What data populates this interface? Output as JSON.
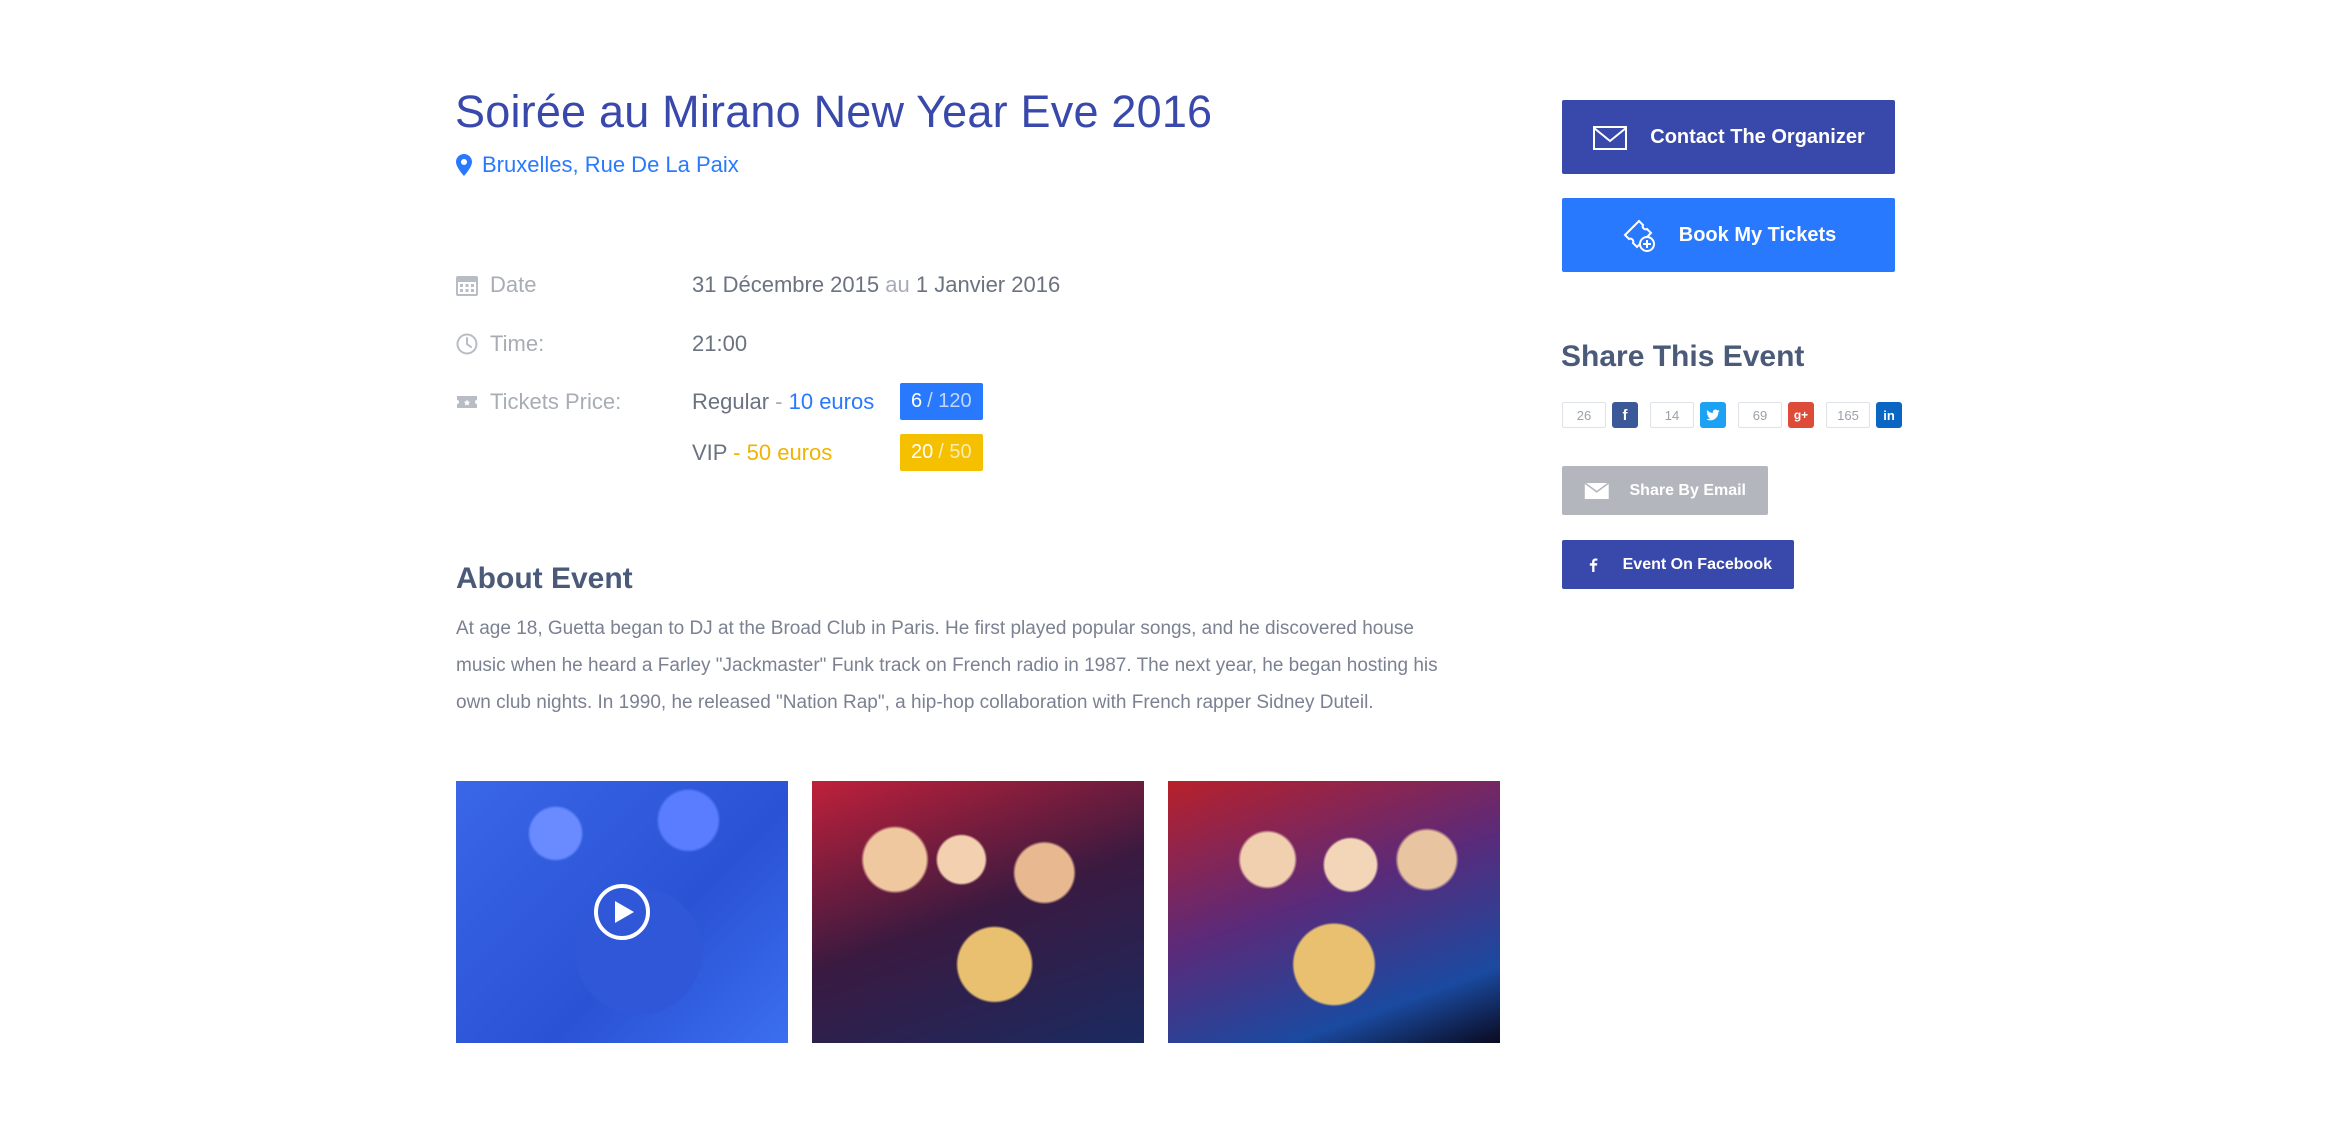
{
  "event": {
    "title": "Soirée au Mirano New Year Eve 2016",
    "location": "Bruxelles, Rue De La Paix"
  },
  "details": {
    "date_label": "Date",
    "date_start": "31 Décembre 2015",
    "date_sep": "au",
    "date_end": "1 Janvier 2016",
    "time_label": "Time:",
    "time_value": "21:00",
    "tickets_label": "Tickets Price:",
    "tickets": [
      {
        "name": "Regular",
        "sep": " - ",
        "price": "10 euros",
        "remaining": "6",
        "total": "/ 120",
        "color": "#2979ff"
      },
      {
        "name": "VIP",
        "sep": " - ",
        "price": "50 euros",
        "remaining": "20",
        "total": "/ 50",
        "color": "#f5c000"
      }
    ]
  },
  "about": {
    "title": "About Event",
    "text": "At age 18, Guetta began to DJ at the Broad Club in Paris. He first played popular songs, and he discovered house music when he heard a Farley \"Jackmaster\" Funk track on French radio in 1987. The next year, he began hosting his own club nights. In 1990, he released \"Nation Rap\", a hip-hop collaboration with French rapper Sidney Duteil."
  },
  "gallery": [
    {
      "kind": "video",
      "icon": "play-icon"
    },
    {
      "kind": "photo"
    },
    {
      "kind": "photo"
    }
  ],
  "sidebar": {
    "contact_label": "Contact The Organizer",
    "book_label": "Book My Tickets",
    "share_title": "Share This Event",
    "share_counts": [
      {
        "network": "facebook",
        "count": "26",
        "glyph": "f"
      },
      {
        "network": "twitter",
        "count": "14",
        "glyph": "t"
      },
      {
        "network": "google-plus",
        "count": "69",
        "glyph": "g+"
      },
      {
        "network": "linkedin",
        "count": "165",
        "glyph": "in"
      }
    ],
    "email_label": "Share By Email",
    "facebook_label": "Event On Facebook"
  },
  "colors": {
    "primary": "#3949ab",
    "accent": "#2979ff",
    "vip": "#f5c000"
  }
}
